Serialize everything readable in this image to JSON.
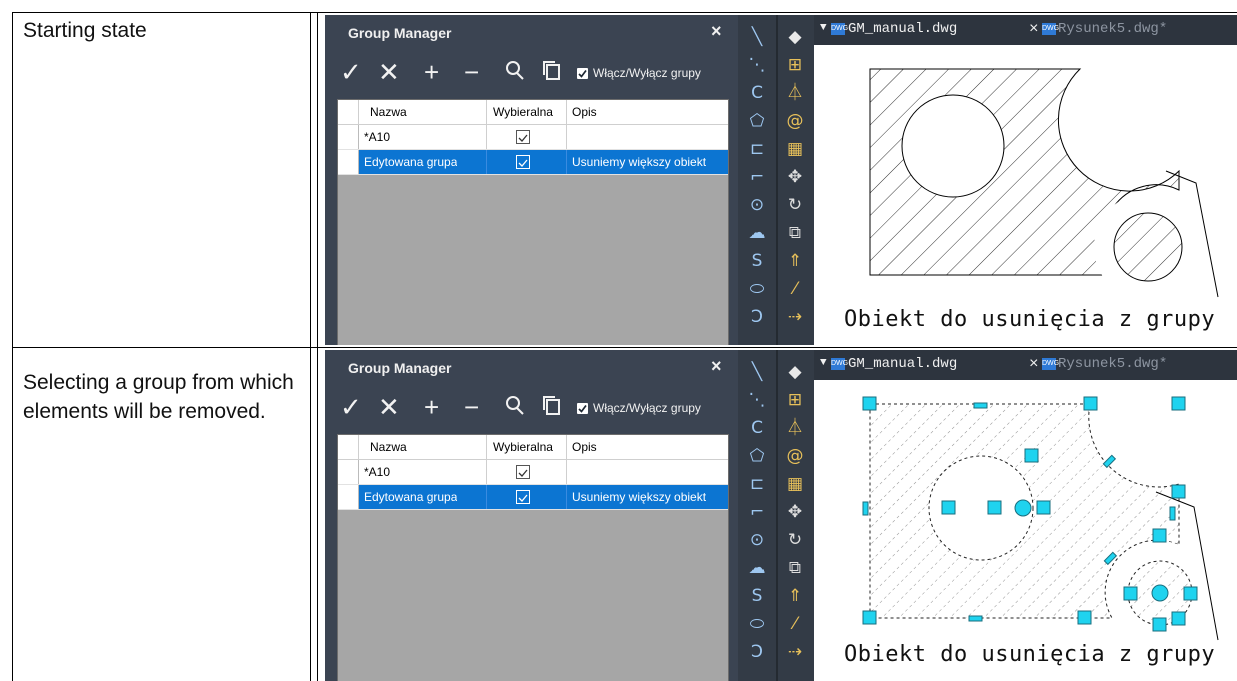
{
  "rows": [
    {
      "label": "Starting state"
    },
    {
      "label": "Selecting a group from which elements will be removed."
    }
  ],
  "group_manager": {
    "title": "Group Manager",
    "close_icon": "×",
    "toolbar": {
      "apply_icon": "✓",
      "delete_icon": "✕",
      "add_icon": "+",
      "remove_icon": "−",
      "search_icon": "⚲",
      "copy_icon": "⧉"
    },
    "toggle_groups_label": "Włącz/Wyłącz grupy",
    "toggle_groups_checked": true,
    "columns": {
      "name": "Nazwa",
      "selectable": "Wybieralna",
      "description": "Opis"
    },
    "groups": [
      {
        "name": "*A10",
        "selectable": true,
        "description": ""
      },
      {
        "name": "Edytowana grupa",
        "selectable": true,
        "description": "Usuniemy większy obiekt"
      }
    ],
    "selected_group": "Edytowana grupa"
  },
  "toolbar_icons": {
    "left": [
      "line-icon",
      "construction-line-icon",
      "arc-icon",
      "polygon-icon",
      "rectangle-icon",
      "polyline-arc-icon",
      "circle-icon",
      "revision-cloud-icon",
      "spline-icon",
      "ellipse-icon",
      "ellipse-arc-icon"
    ],
    "right": [
      "eraser-icon",
      "copy-icon",
      "mirror-icon",
      "offset-icon",
      "array-icon",
      "move-icon",
      "rotate-icon",
      "scale-icon",
      "stretch-icon",
      "trim-icon",
      "extend-icon"
    ]
  },
  "tabs": [
    {
      "name": "GM_manual.dwg",
      "active": true,
      "close_icon": "×"
    },
    {
      "name": "Rysunek5.dwg*",
      "active": false
    }
  ],
  "drawing_caption": "Obiekt do usunięcia z grupy",
  "colors": {
    "panel_bg": "#3b4452",
    "selection": "#0c75d2",
    "grip": "#1fd3ef"
  }
}
